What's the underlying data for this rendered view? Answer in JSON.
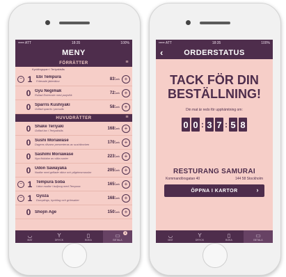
{
  "menu_screen": {
    "status": {
      "carrier": "••••• ATT",
      "time": "18:35",
      "battery": "100%"
    },
    "title": "MENY",
    "sections": [
      {
        "title": "FÖRRÄTTER",
        "top_subtext": "Kycklingsparr i Teriyakisås",
        "items": [
          {
            "qty": "1",
            "has_minus": true,
            "name": "Ebi Tempura",
            "desc": "Friterade jätteräkor",
            "price": "83:",
            "sek": "sek"
          },
          {
            "qty": "0",
            "has_minus": false,
            "name": "Gyu Negimak",
            "desc": "Rullad Entrecote med purjolök",
            "price": "72:",
            "sek": "sek"
          },
          {
            "qty": "0",
            "has_minus": false,
            "name": "Sparris Kushiyaki",
            "desc": "Grillad sparris i porssås",
            "price": "58:",
            "sek": "sek"
          }
        ]
      },
      {
        "title": "HUVUDRÄTTER",
        "items": [
          {
            "qty": "0",
            "has_minus": false,
            "name": "Shake Teriyaki",
            "desc": "Grillad lax i Teriyakisås",
            "price": "168:",
            "sek": "sek"
          },
          {
            "qty": "0",
            "has_minus": false,
            "name": "Sushi Moriawase",
            "desc": "Dagens råvaror presenteras av sushikocken",
            "price": "170:",
            "sek": "sek"
          },
          {
            "qty": "0",
            "has_minus": false,
            "name": "Sashimi Moriawase",
            "desc": "Nya fiskbitar av olika sorter",
            "price": "223:",
            "sek": "sek"
          },
          {
            "qty": "0",
            "has_minus": false,
            "name": "Udon Sawayaka",
            "desc": "Nudlar med grillade räkor och pilgrimsmusslor",
            "price": "205:",
            "sek": "sek"
          },
          {
            "qty": "1",
            "has_minus": true,
            "name": "Tempura Soba",
            "desc": "Udon nudlar i buljong med Tempura",
            "price": "165:",
            "sek": "sek"
          },
          {
            "qty": "1",
            "has_minus": true,
            "name": "Gyoza",
            "desc": "Dumplings, kyckling och grönsaker",
            "price": "168:",
            "sek": "sek"
          },
          {
            "qty": "0",
            "has_minus": false,
            "name": "Shojin Age",
            "desc": "",
            "price": "150:",
            "sek": "sek"
          }
        ]
      }
    ],
    "tabs": [
      {
        "label": "MAT",
        "icon": "bowl-icon",
        "glyph": "◡",
        "active": false
      },
      {
        "label": "DRYCK",
        "icon": "cocktail-icon",
        "glyph": "Y",
        "active": false
      },
      {
        "label": "BOKA",
        "icon": "book-icon",
        "glyph": "▯",
        "active": false
      },
      {
        "label": "BETALA",
        "icon": "receipt-icon",
        "glyph": "▭",
        "active": true,
        "badge": "3"
      }
    ]
  },
  "order_screen": {
    "status": {
      "carrier": "••••• ATT",
      "time": "18:35",
      "battery": "100%"
    },
    "title": "ORDERSTATUS",
    "back_glyph": "‹",
    "thanks_line1": "TACK FÖR DIN",
    "thanks_line2": "BESTÄLLNING!",
    "ready_text": "Din mat är redo för upphämtning om:",
    "timer_digits": [
      "0",
      "0",
      "3",
      "7",
      "5",
      "8"
    ],
    "restaurant_name": "RESTURANG SAMURAI",
    "address_street": "Kommandörsgatan 40",
    "address_city": "144 58 Stockholm",
    "open_button": "ÖPPNA I KARTOR",
    "open_arrow": "›",
    "tabs": [
      {
        "label": "MAT",
        "icon": "bowl-icon",
        "glyph": "◡",
        "active": false
      },
      {
        "label": "DRYCK",
        "icon": "cocktail-icon",
        "glyph": "Y",
        "active": false
      },
      {
        "label": "BOKA",
        "icon": "book-icon",
        "glyph": "▯",
        "active": false
      },
      {
        "label": "BETALA",
        "icon": "receipt-icon",
        "glyph": "▭",
        "active": true
      }
    ]
  },
  "colors": {
    "primary": "#4e2d4c",
    "background": "#f6cec8"
  }
}
